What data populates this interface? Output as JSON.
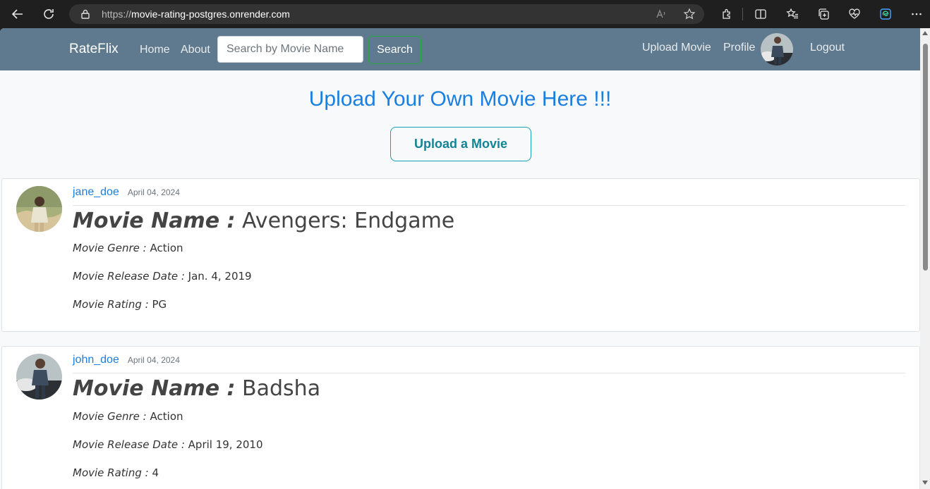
{
  "browser": {
    "url_prefix": "https://",
    "url_host": "movie-rating-postgres.onrender.com"
  },
  "navbar": {
    "brand": "RateFlix",
    "home": "Home",
    "about": "About",
    "search_placeholder": "Search by Movie Name",
    "search_button": "Search",
    "upload_movie": "Upload Movie",
    "profile": "Profile",
    "logout": "Logout"
  },
  "hero": {
    "title": "Upload Your Own Movie Here !!!",
    "button": "Upload a Movie"
  },
  "labels": {
    "movie_name": "Movie Name :",
    "genre": "Movie Genre :",
    "release": "Movie Release Date :",
    "rating": "Movie Rating :"
  },
  "posts": [
    {
      "username": "jane_doe",
      "date": "April 04, 2024",
      "movie_name": "Avengers: Endgame",
      "genre": "Action",
      "release_date": "Jan. 4, 2019",
      "rating": "PG"
    },
    {
      "username": "john_doe",
      "date": "April 04, 2024",
      "movie_name": "Badsha",
      "genre": "Action",
      "release_date": "April 19, 2010",
      "rating": "4"
    }
  ],
  "colors": {
    "navbar": "#5f7a8e",
    "link": "#1a7fe0",
    "search_border": "#28a745",
    "upload_border": "#17a2b8"
  }
}
